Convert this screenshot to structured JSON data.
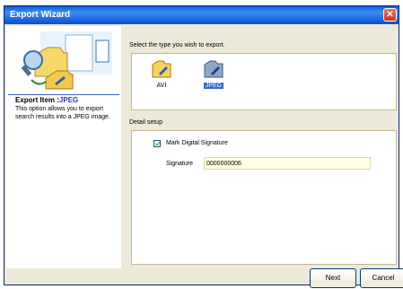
{
  "window": {
    "title": "Export Wizard"
  },
  "left_panel": {
    "export_item_label": "Export Item :",
    "export_item_value": "JPEG",
    "description": "This option allows you to export search results into a JPEG image."
  },
  "type_section": {
    "label": "Select the type you wish to export.",
    "types": [
      {
        "label": "AVI",
        "icon": "folder-avi-icon",
        "selected": false
      },
      {
        "label": "JPEG",
        "icon": "folder-jpeg-icon",
        "selected": true
      }
    ]
  },
  "detail_section": {
    "label": "Detail setup",
    "mark_signature": {
      "label": "Mark Digital Signature",
      "checked": true
    },
    "signature": {
      "label": "Signature",
      "value": "0000000006"
    }
  },
  "buttons": {
    "next": "Next",
    "cancel": "Cancel"
  }
}
